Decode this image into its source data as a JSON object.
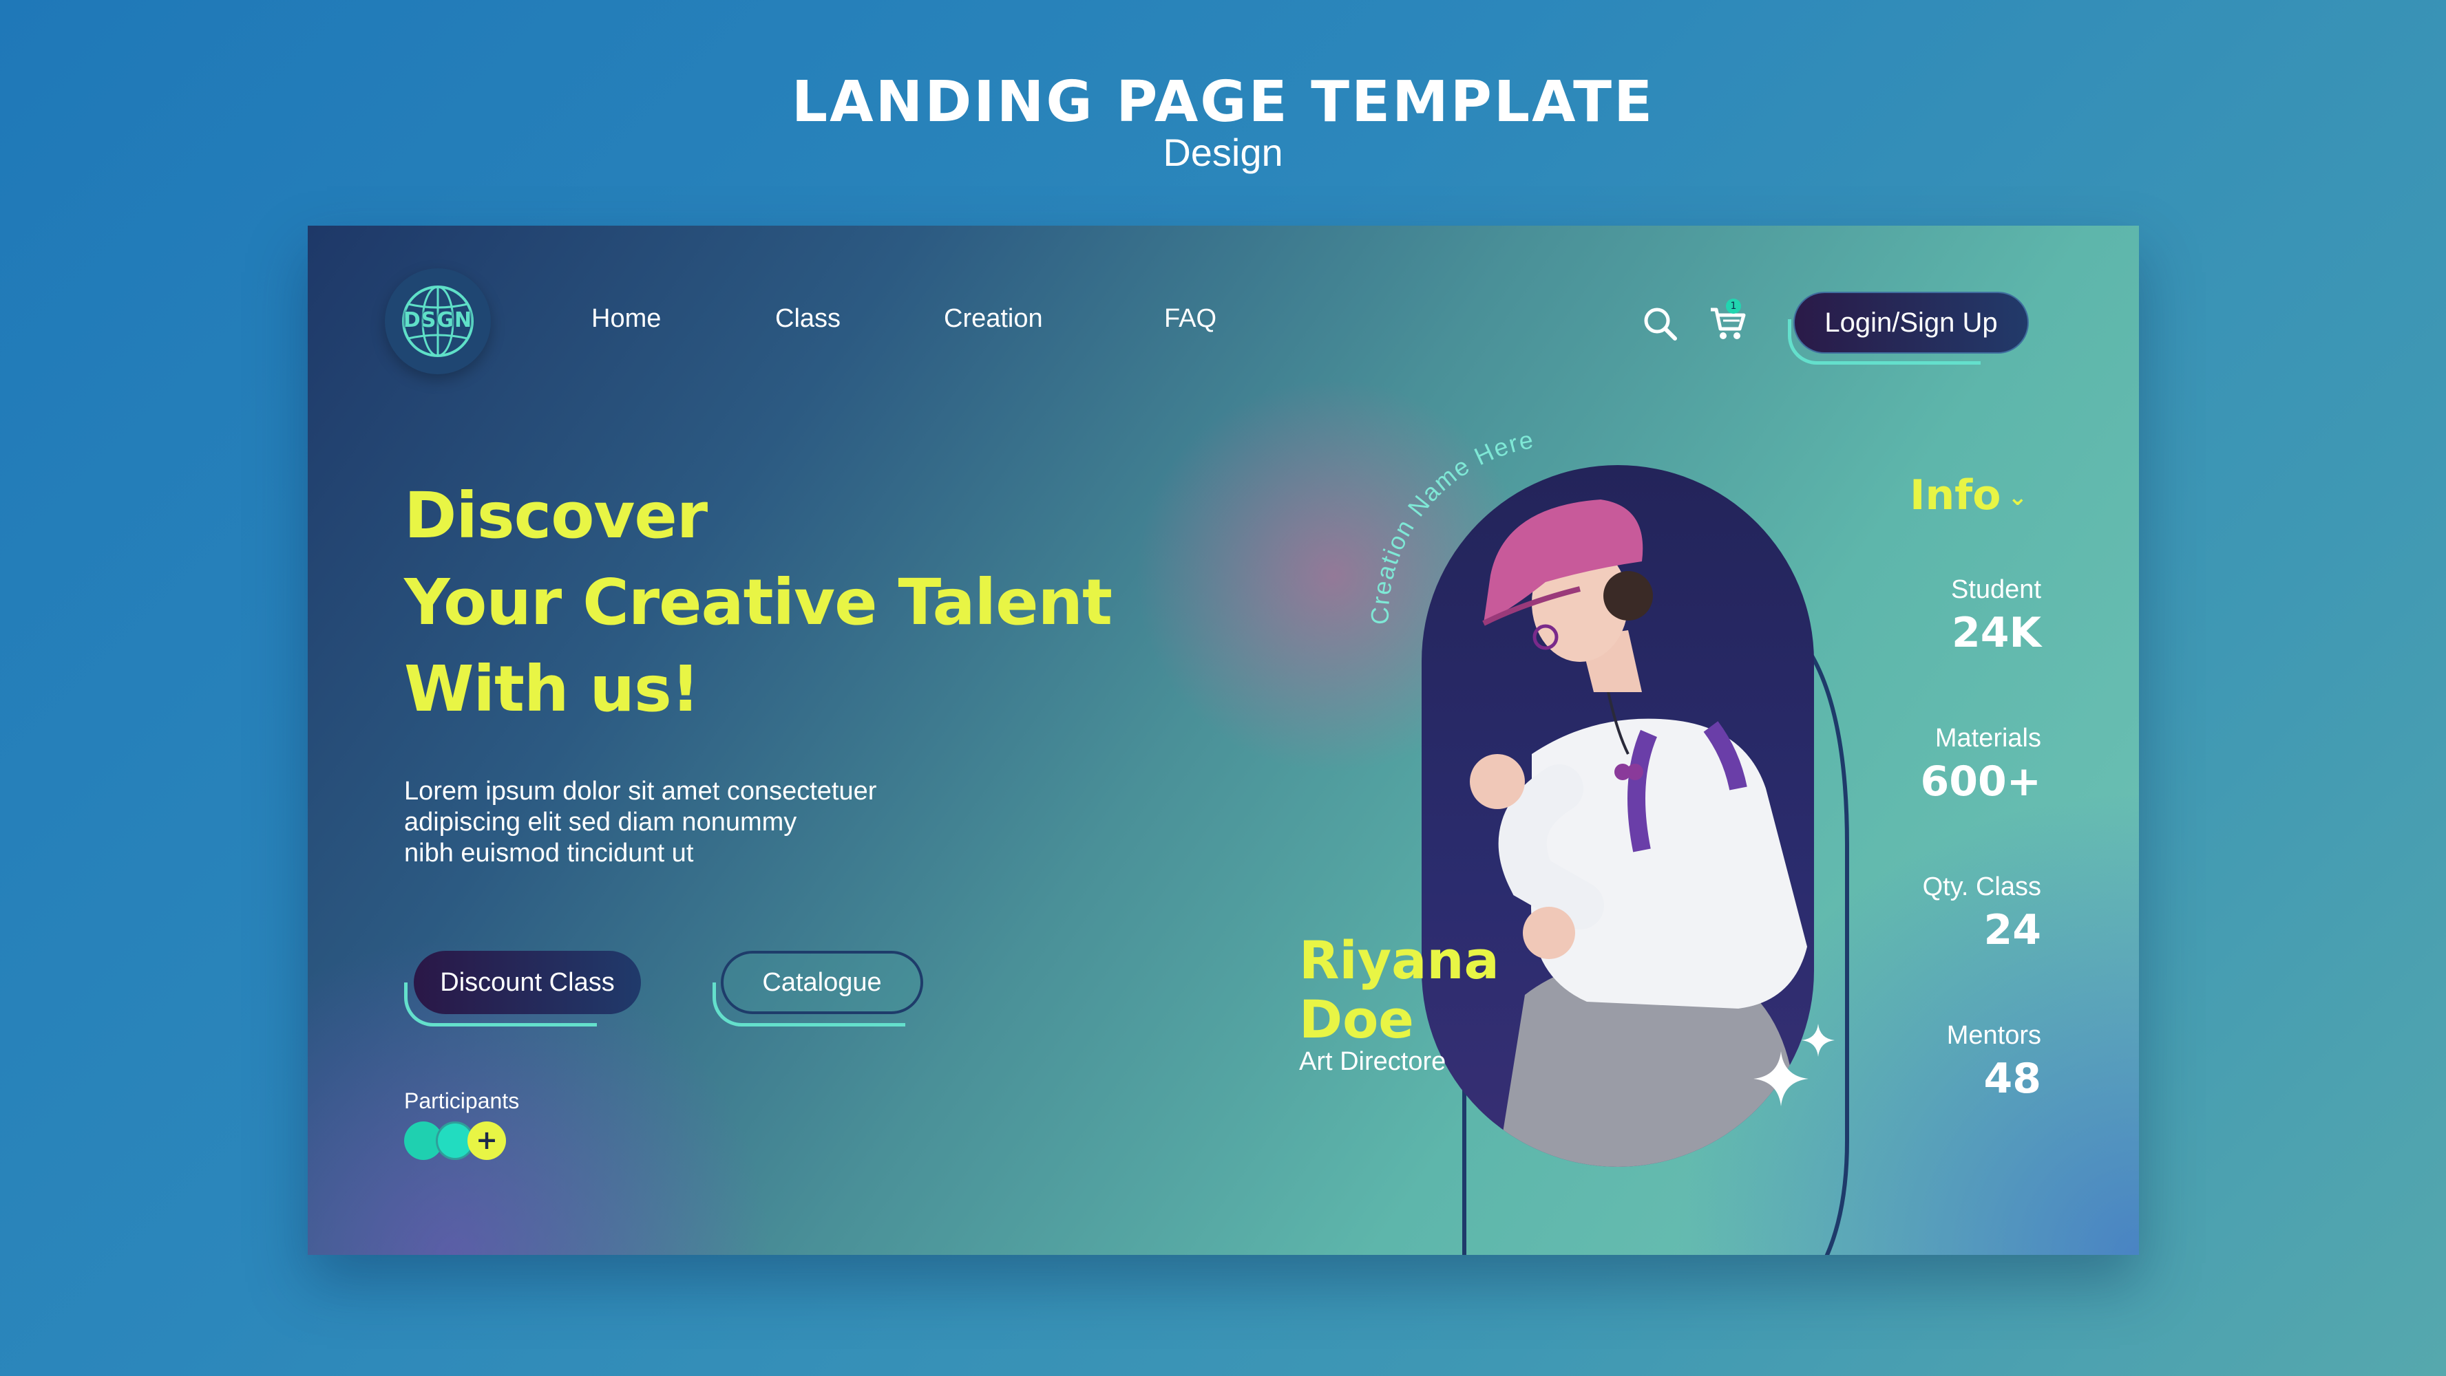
{
  "header": {
    "title": "LANDING PAGE TEMPLATE",
    "subtitle": "Design"
  },
  "logo": {
    "text": "DSGN",
    "icon": "globe-icon"
  },
  "nav": {
    "items": [
      {
        "label": "Home"
      },
      {
        "label": "Class"
      },
      {
        "label": "Creation"
      },
      {
        "label": "FAQ"
      }
    ]
  },
  "toolbar": {
    "search_icon": "search-icon",
    "cart_icon": "cart-icon",
    "cart_count": "1",
    "login_label": "Login/Sign Up"
  },
  "hero": {
    "headline": [
      "Discover",
      "Your Creative Talent",
      "With us!"
    ],
    "description": [
      "Lorem ipsum dolor sit amet consectetuer",
      "adipiscing elit sed diam nonummy",
      "nibh euismod tincidunt ut"
    ],
    "primary_button": "Discount Class",
    "secondary_button": "Catalogue",
    "participants_label": "Participants",
    "participants_add": "+"
  },
  "profile": {
    "curved_label": "Creation Name Here",
    "first_name": "Riyana",
    "last_name": "Doe",
    "role": "Art Directore"
  },
  "info": {
    "title": "Info",
    "stats": [
      {
        "label": "Student",
        "value": "24K"
      },
      {
        "label": "Materials",
        "value": "600+"
      },
      {
        "label": "Qty. Class",
        "value": "24"
      },
      {
        "label": "Mentors",
        "value": "48"
      }
    ]
  },
  "colors": {
    "accent_yellow": "#e8f545",
    "accent_teal": "#22d5b0",
    "button_dark": "#2a1747",
    "hat_pink": "#c85a9a"
  }
}
